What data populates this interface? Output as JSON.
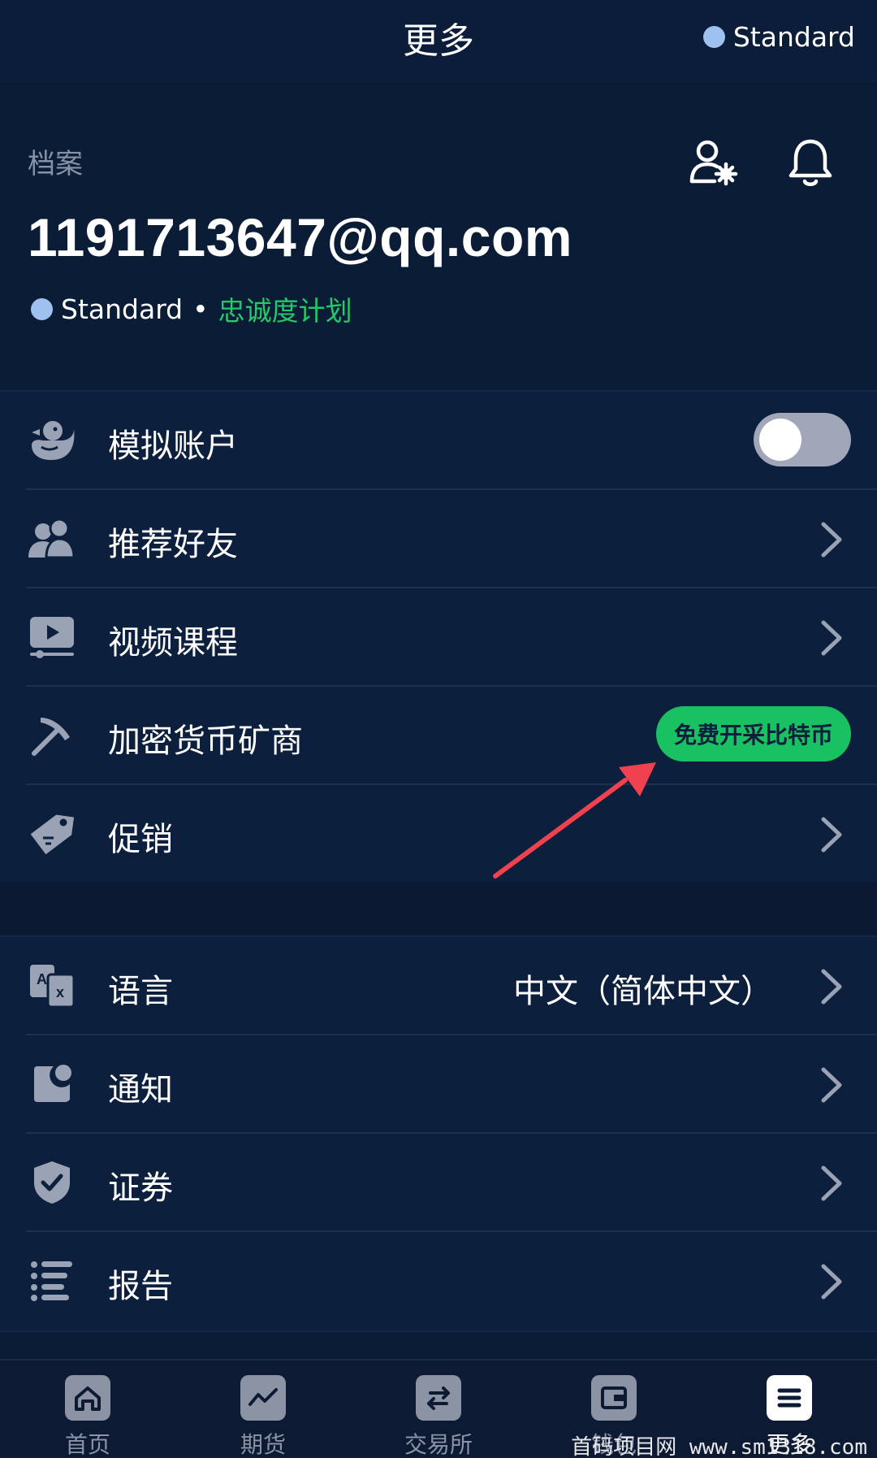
{
  "header": {
    "title": "更多",
    "account_type": "Standard"
  },
  "profile": {
    "label": "档案",
    "email": "1191713647@qq.com",
    "tier": "Standard",
    "separator": "•",
    "loyalty": "忠诚度计划"
  },
  "section1": {
    "items": [
      {
        "label": "模拟账户",
        "control": "toggle",
        "toggle_on": false
      },
      {
        "label": "推荐好友"
      },
      {
        "label": "视频课程"
      },
      {
        "label": "加密货币矿商",
        "badge": "免费开采比特币"
      },
      {
        "label": "促销"
      }
    ]
  },
  "section2": {
    "items": [
      {
        "label": "语言",
        "value": "中文（简体中文）"
      },
      {
        "label": "通知"
      },
      {
        "label": "证券"
      },
      {
        "label": "报告"
      }
    ]
  },
  "nav": {
    "items": [
      {
        "label": "首页"
      },
      {
        "label": "期货"
      },
      {
        "label": "交易所"
      },
      {
        "label": "钱包"
      },
      {
        "label": "更多",
        "active": true
      }
    ]
  },
  "watermark": "首码项目网 www.sm1318.com",
  "colors": {
    "background": "#0b1c37",
    "accent_green": "#19c163",
    "tier_dot": "#9ec1ef",
    "arrow": "#f0414f"
  }
}
